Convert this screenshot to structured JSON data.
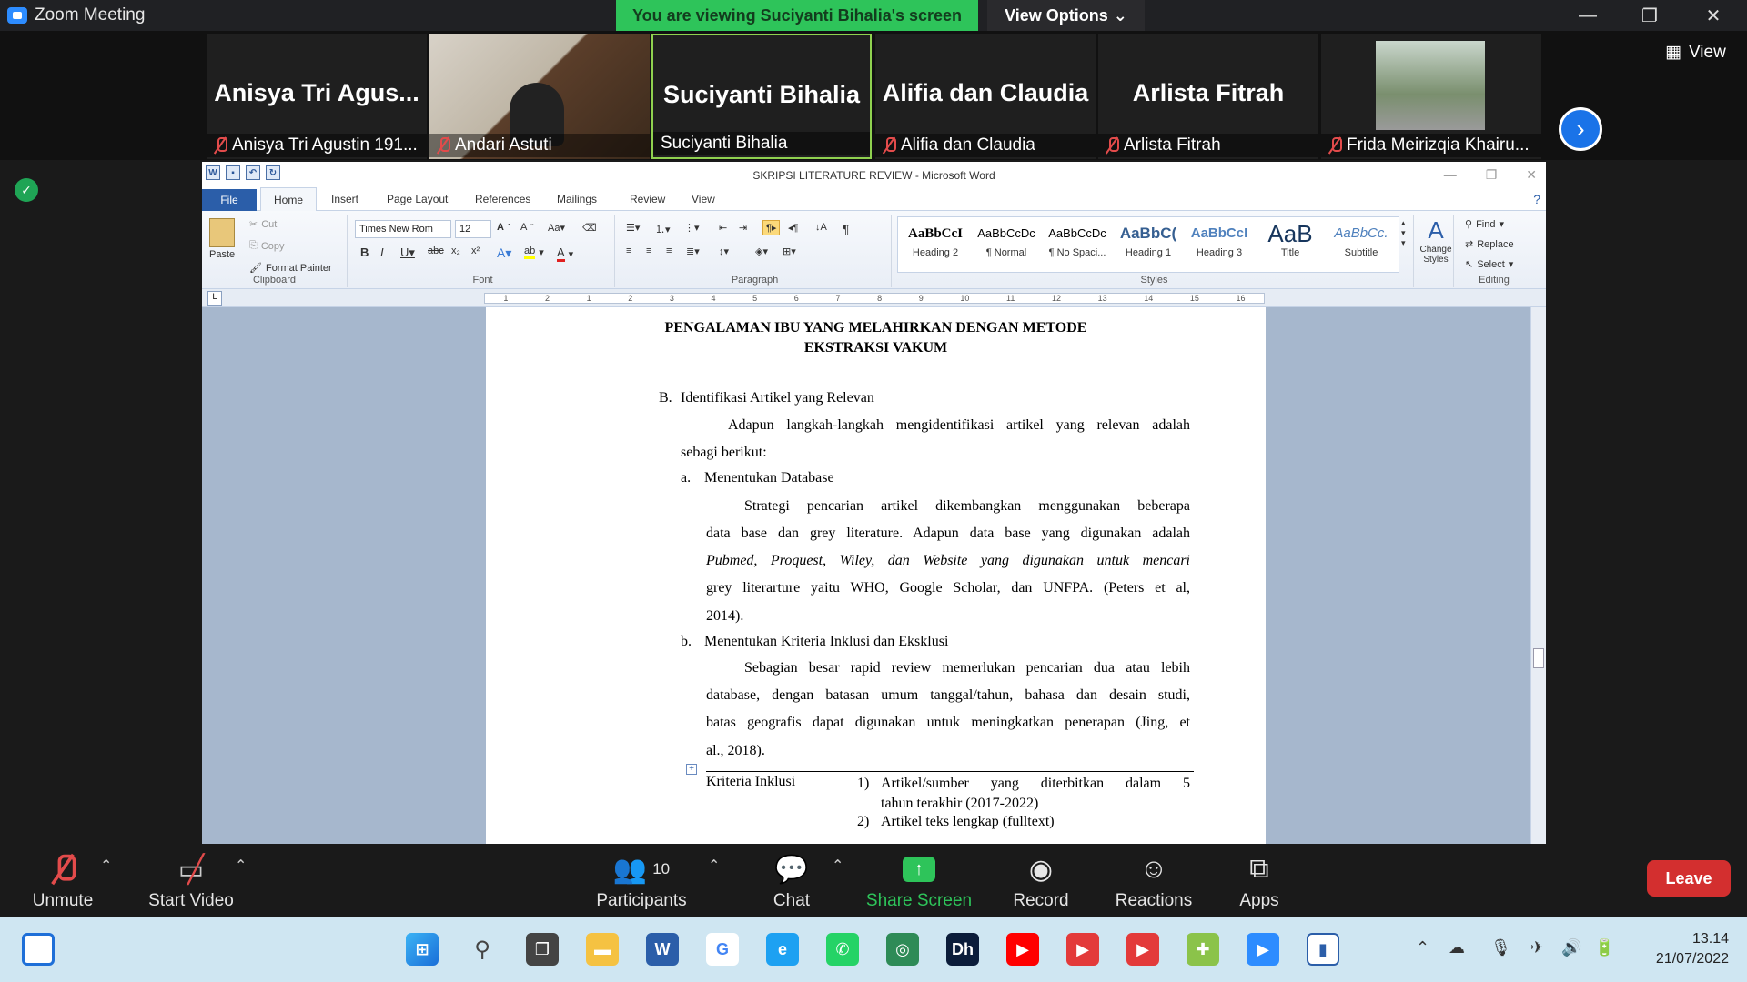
{
  "zoom": {
    "window_title": "Zoom Meeting",
    "viewing_banner": "You are viewing Suciyanti Bihalia's screen",
    "view_options": "View Options",
    "view_label": "View",
    "participants": [
      {
        "big": "Anisya  Tri  Agus...",
        "caption": "Anisya Tri Agustin 191...",
        "muted": true
      },
      {
        "big": "",
        "caption": "Andari Astuti",
        "muted": true
      },
      {
        "big": "Suciyanti Bihalia",
        "caption": "Suciyanti Bihalia",
        "muted": false
      },
      {
        "big": "Alifia dan Claudia",
        "caption": "Alifia dan Claudia",
        "muted": true
      },
      {
        "big": "Arlista Fitrah",
        "caption": "Arlista Fitrah",
        "muted": true
      },
      {
        "big": "",
        "caption": "Frida Meirizqia Khairu...",
        "muted": true
      }
    ],
    "toolbar": {
      "unmute": "Unmute",
      "start_video": "Start Video",
      "participants": "Participants",
      "participants_count": "10",
      "chat": "Chat",
      "share_screen": "Share Screen",
      "record": "Record",
      "reactions": "Reactions",
      "apps": "Apps",
      "leave": "Leave"
    },
    "colors": {
      "share_green": "#2ec45a",
      "leave_red": "#d32f2f",
      "accent_blue": "#1a73e8"
    }
  },
  "word": {
    "title": "SKRIPSI LITERATURE REVIEW  -  Microsoft Word",
    "tabs": [
      "File",
      "Home",
      "Insert",
      "Page Layout",
      "References",
      "Mailings",
      "Review",
      "View"
    ],
    "clipboard": {
      "paste": "Paste",
      "cut": "Cut",
      "copy": "Copy",
      "format_painter": "Format Painter",
      "label": "Clipboard"
    },
    "font": {
      "name": "Times New Rom",
      "size": "12",
      "label": "Font"
    },
    "paragraph_label": "Paragraph",
    "styles": [
      {
        "sample": "AaBbCcI",
        "name": "Heading 2"
      },
      {
        "sample": "AaBbCcDc",
        "name": "¶ Normal"
      },
      {
        "sample": "AaBbCcDc",
        "name": "¶ No Spaci..."
      },
      {
        "sample": "AaBbC(",
        "name": "Heading 1"
      },
      {
        "sample": "AaBbCcI",
        "name": "Heading 3"
      },
      {
        "sample": "AaB",
        "name": "Title"
      },
      {
        "sample": "AaBbCc.",
        "name": "Subtitle"
      }
    ],
    "styles_label": "Styles",
    "change_styles": "Change Styles",
    "editing": {
      "find": "Find",
      "replace": "Replace",
      "select": "Select",
      "label": "Editing"
    },
    "ruler_ticks": [
      "1",
      "2",
      "1",
      "2",
      "3",
      "4",
      "5",
      "6",
      "7",
      "8",
      "9",
      "10",
      "11",
      "12",
      "13",
      "14",
      "15",
      "16"
    ]
  },
  "document": {
    "title_line1": "PENGALAMAN IBU YANG MELAHIRKAN DENGAN METODE",
    "title_line2": "EKSTRAKSI VAKUM",
    "section_b_marker": "B.",
    "section_b": "Identifikasi Artikel yang Relevan",
    "intro_1": "Adapun langkah-langkah mengidentifikasi artikel yang relevan adalah",
    "intro_2": "sebagi berikut:",
    "a_marker": "a.",
    "a_heading": "Menentukan Database",
    "a_p1": "Strategi  pencarian  artikel  dikembangkan  menggunakan  beberapa",
    "a_p2": "data base dan grey literature. Adapun data base yang digunakan adalah",
    "a_p3": "Pubmed, Proquest, Wiley, dan Website yang digunakan untuk mencari",
    "a_p4": "grey literarture yaitu WHO, Google Scholar, dan UNFPA. (Peters et al,",
    "a_p5": "2014).",
    "b_marker": "b.",
    "b_heading": "Menentukan Kriteria Inklusi dan Eksklusi",
    "b_p1": "Sebagian besar rapid review memerlukan pencarian dua atau lebih",
    "b_p2": "database, dengan batasan umum tanggal/tahun, bahasa dan desain studi,",
    "b_p3": "batas geografis dapat digunakan untuk meningkatkan penerapan (Jing, et",
    "b_p4": "al., 2018).",
    "table_label": "Kriteria Inklusi",
    "table_i1_num": "1)",
    "table_i1_a": "Artikel/sumber  yang  diterbitkan  dalam  5",
    "table_i1_b": "tahun terakhir (2017-2022)",
    "table_i2_num": "2)",
    "table_i2": "Artikel teks lengkap (fulltext)"
  },
  "taskbar": {
    "time": "13.14",
    "date": "21/07/2022"
  }
}
